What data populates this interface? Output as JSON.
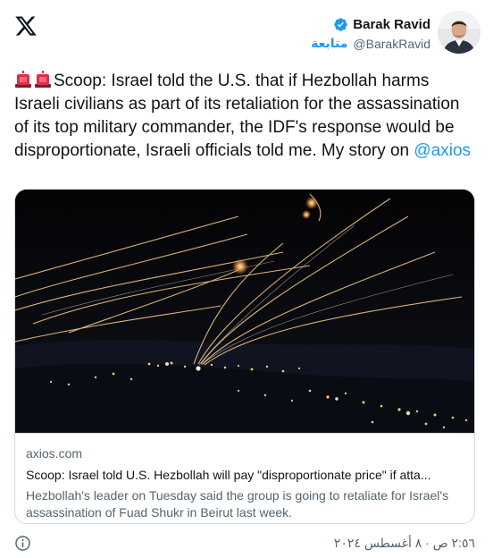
{
  "header": {
    "display_name": "Barak Ravid",
    "handle": "@BarakRavid",
    "follow_label": "متابعة",
    "verified_icon": "verified-badge-icon",
    "brand_icon": "x-logo-icon",
    "accent_color": "#1d9bf0"
  },
  "tweet": {
    "emoji": "siren-icon",
    "text": "Scoop: Israel told the U.S. that if Hezbollah harms Israeli civilians as part of its retaliation for the assassination of its top military commander, the IDF's response would be disproportionate, Israeli officials told me. My story on ",
    "mention": "@axios"
  },
  "card": {
    "domain": "axios.com",
    "title": "Scoop: Israel told U.S. Hezbollah will pay \"disproportionate price\" if atta...",
    "description": "Hezbollah's leader on Tuesday said the group is going to retaliate for Israel's assassination of Fuad Shukr in Beirut last week."
  },
  "footer": {
    "timestamp": "٢:٥٦ ص · ٨ أغسطس ٢٠٢٤",
    "info_icon": "info-icon"
  }
}
